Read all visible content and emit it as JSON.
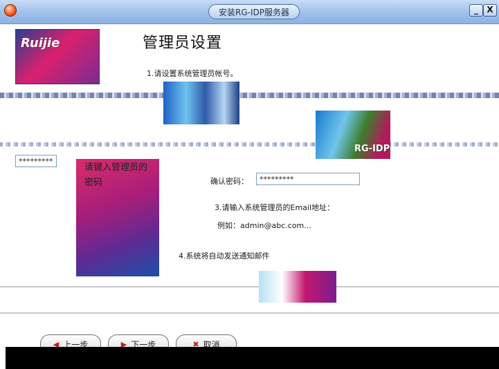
{
  "window": {
    "title": "安装RG-IDP服务器",
    "minimize_glyph": "_",
    "close_glyph": "X"
  },
  "header": {
    "logo_text": "Ruijie",
    "page_title": "管理员设置",
    "step1": "1.请设置系统管理员帐号。"
  },
  "graphic": {
    "product_label": "RG-IDP",
    "side_caption": "请键入管理员的密码"
  },
  "form": {
    "password_label": "确认密码：",
    "password_value": "*********",
    "left_field_value": "*********",
    "email_label": "3.请输入系统管理员的Email地址：",
    "email_example": "例如：admin@abc.com...",
    "notify_label": "4.系统将自动发送通知邮件"
  },
  "buttons": {
    "back": "上一步",
    "next": "下一步",
    "cancel": "取消"
  },
  "icons": {
    "back": "arrow-left-icon",
    "next": "arrow-right-icon",
    "cancel": "cancel-icon"
  }
}
